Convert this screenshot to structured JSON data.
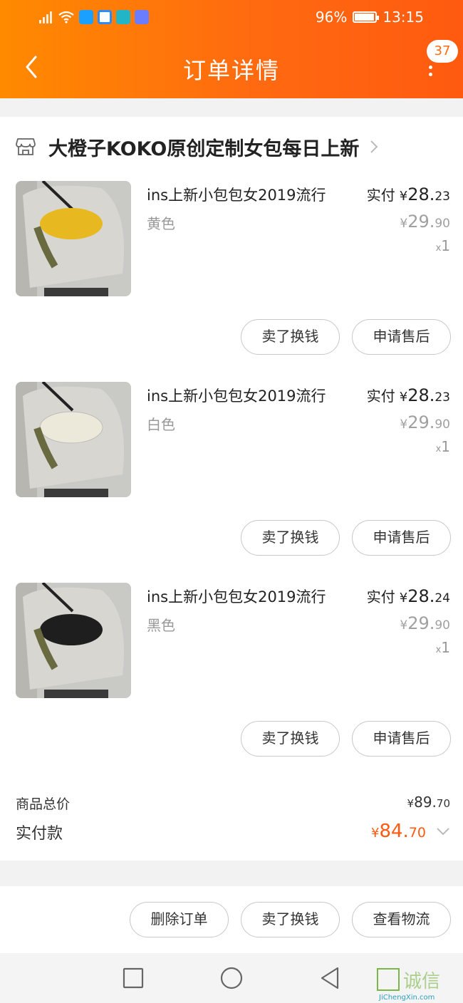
{
  "status_bar": {
    "battery": "96%",
    "time": "13:15",
    "battery_level": 0.96
  },
  "nav": {
    "title": "订单详情",
    "badge_count": "37"
  },
  "shop": {
    "name": "大橙子KOKO原创定制女包每日上新"
  },
  "items": [
    {
      "title": "ins上新小包包女2019流行",
      "variant": "黄色",
      "actual_label": "实付",
      "yen": "¥",
      "actual_int": "28.",
      "actual_dec": "23",
      "orig_int": "29.",
      "orig_dec": "90",
      "qty_x": "x",
      "qty": "1",
      "btn_sell": "卖了换钱",
      "btn_after": "申请售后",
      "bag_color": "#e8b820"
    },
    {
      "title": "ins上新小包包女2019流行",
      "variant": "白色",
      "actual_label": "实付",
      "yen": "¥",
      "actual_int": "28.",
      "actual_dec": "23",
      "orig_int": "29.",
      "orig_dec": "90",
      "qty_x": "x",
      "qty": "1",
      "btn_sell": "卖了换钱",
      "btn_after": "申请售后",
      "bag_color": "#ece8da"
    },
    {
      "title": "ins上新小包包女2019流行",
      "variant": "黑色",
      "actual_label": "实付",
      "yen": "¥",
      "actual_int": "28.",
      "actual_dec": "24",
      "orig_int": "29.",
      "orig_dec": "90",
      "qty_x": "x",
      "qty": "1",
      "btn_sell": "卖了换钱",
      "btn_after": "申请售后",
      "bag_color": "#1e1e1e"
    }
  ],
  "totals": {
    "goods_label": "商品总价",
    "goods_yen": "¥",
    "goods_int": "89.",
    "goods_dec": "70",
    "paid_label": "实付款",
    "paid_yen": "¥",
    "paid_int": "84.",
    "paid_dec": "70"
  },
  "actions": {
    "delete": "删除订单",
    "sell": "卖了换钱",
    "logistics": "查看物流"
  },
  "watermark": {
    "text": "诚信",
    "sub": "JiChengXin.com"
  },
  "colors": {
    "accent": "#ff6a10",
    "price": "#ff5a10"
  }
}
